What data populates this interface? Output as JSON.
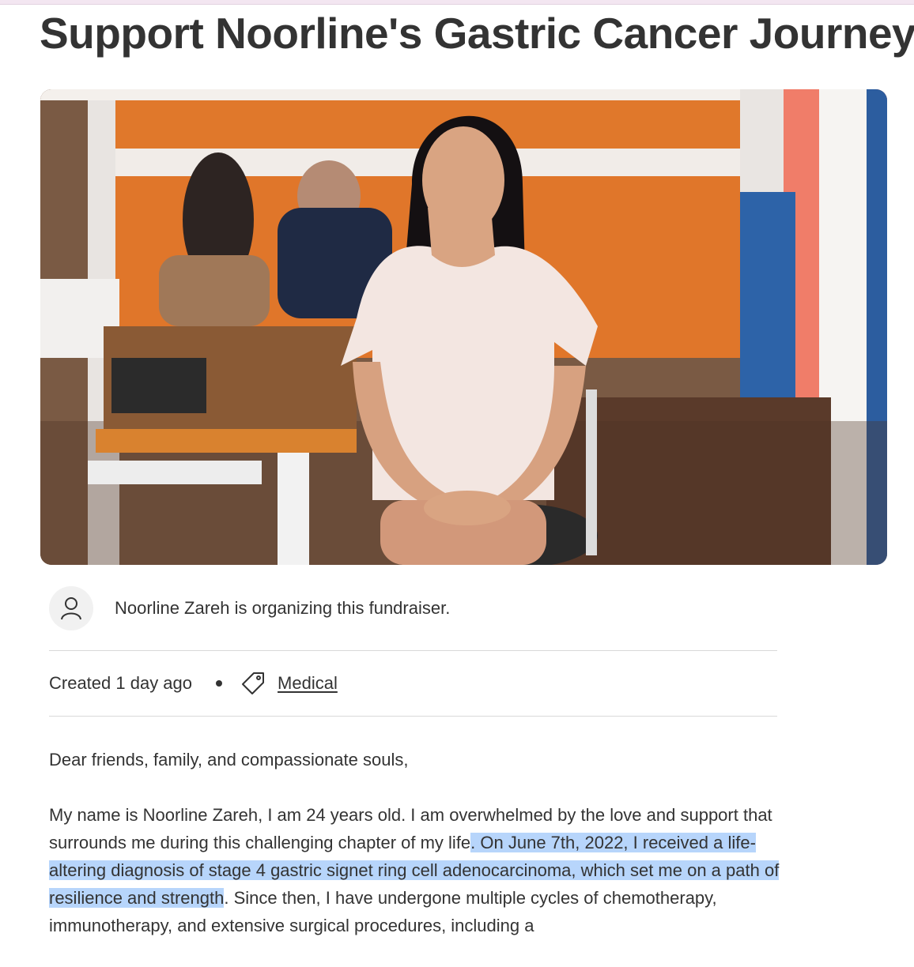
{
  "page": {
    "title": "Support Noorline's Gastric Cancer Journey"
  },
  "hero_image": {
    "icon": "photo-of-woman-seated-in-cafe"
  },
  "organizer": {
    "avatar_icon": "user-icon",
    "text": "Noorline Zareh is organizing this fundraiser."
  },
  "meta": {
    "created": "Created 1 day ago",
    "category_icon": "tag-icon",
    "category": "Medical"
  },
  "story": {
    "greeting": "Dear friends, family, and compassionate souls,",
    "p1_part1": "My name is Noorline Zareh, I am 24 years old. I am overwhelmed by the love and support that surrounds me during this challenging chapter of my life",
    "p1_highlight": ". On June 7th, 2022, I received a life-altering diagnosis of stage 4 gastric signet ring cell adenocarcinoma, which set me on a path of resilience and strength",
    "p1_part2": ". Since then, I have undergone multiple cycles of chemotherapy, immunotherapy, and extensive surgical procedures, including a",
    "highlight_color": "#b7d5fb"
  }
}
